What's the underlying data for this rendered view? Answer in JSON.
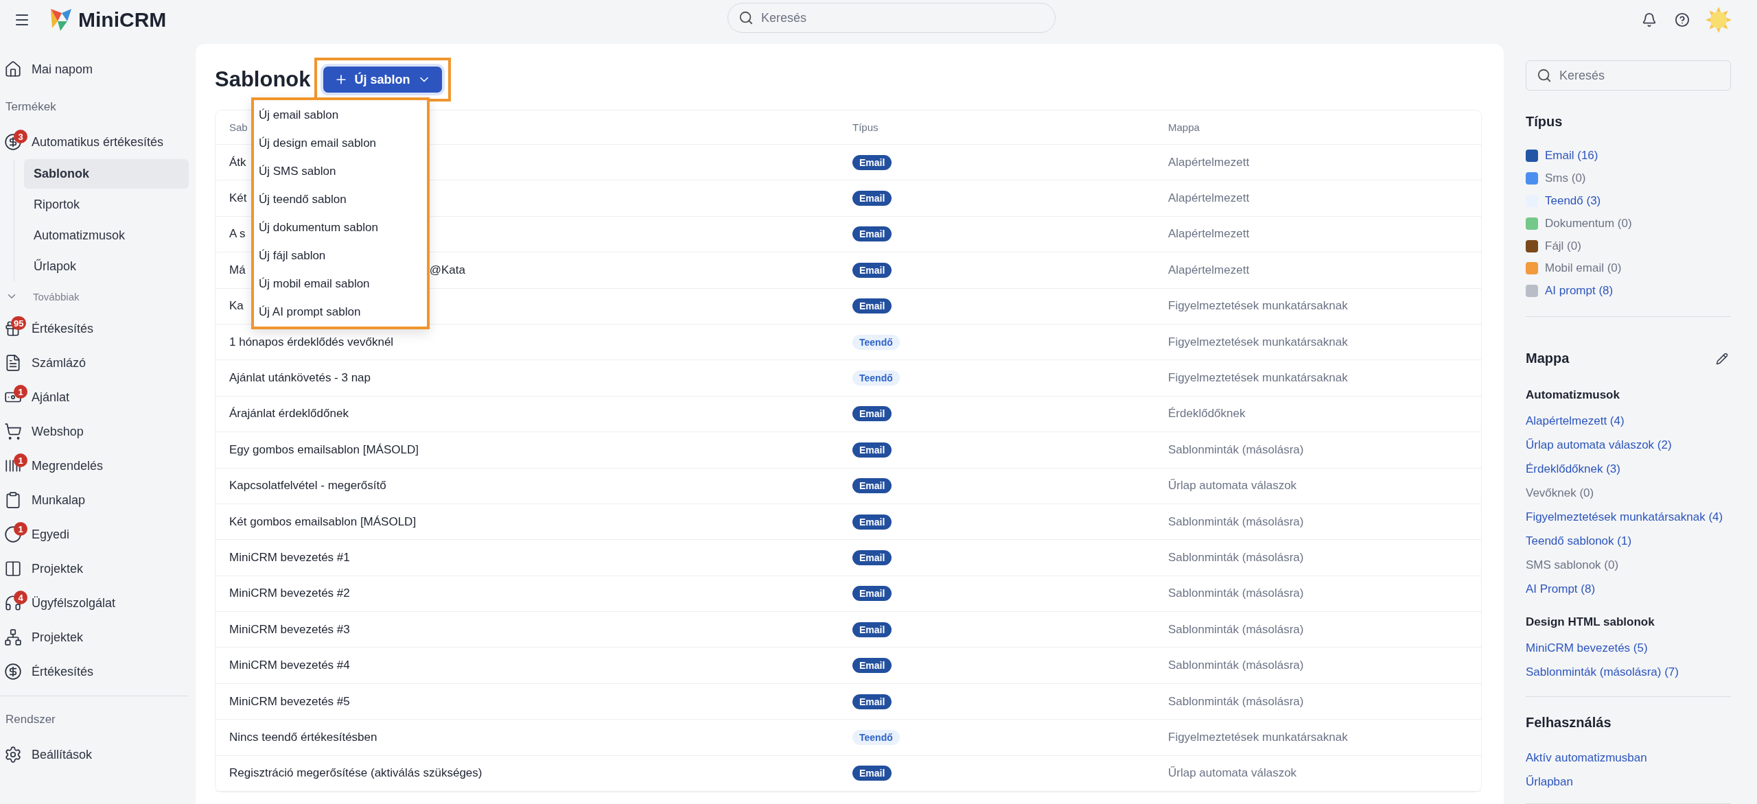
{
  "topbar": {
    "logo": "MiniCRM",
    "search": {
      "placeholder": "Keresés"
    }
  },
  "sidebar": {
    "items": [
      {
        "kind": "item",
        "label": "Mai napom",
        "selected": false
      },
      {
        "kind": "section",
        "label": "Termékek"
      },
      {
        "kind": "item",
        "label": "Automatikus értékesítés",
        "badge": "3",
        "selected": false,
        "children": [
          {
            "label": "Sablonok",
            "selected": true
          },
          {
            "label": "Riportok",
            "selected": false
          },
          {
            "label": "Automatizmusok",
            "selected": false
          },
          {
            "label": "Űrlapok",
            "selected": false
          }
        ]
      },
      {
        "kind": "toggle",
        "label": "Továbbiak",
        "expanded": true
      },
      {
        "kind": "item",
        "label": "Értékesítés",
        "badge": "95",
        "selected": false
      },
      {
        "kind": "item",
        "label": "Számlázó",
        "selected": false
      },
      {
        "kind": "item",
        "label": "Ajánlat",
        "badge": "1",
        "selected": false
      },
      {
        "kind": "item",
        "label": "Webshop",
        "selected": false
      },
      {
        "kind": "item",
        "label": "Megrendelés",
        "badge": "1",
        "selected": false
      },
      {
        "kind": "item",
        "label": "Munkalap",
        "selected": false
      },
      {
        "kind": "item",
        "label": "Egyedi",
        "badge": "1",
        "selected": false
      },
      {
        "kind": "item",
        "label": "Projektek",
        "selected": false
      },
      {
        "kind": "item",
        "label": "Ügyfélszolgálat",
        "badge": "4",
        "selected": false
      },
      {
        "kind": "item",
        "label": "Projektek",
        "selected": false
      },
      {
        "kind": "item",
        "label": "Értékesítés",
        "selected": false
      },
      {
        "kind": "divider"
      },
      {
        "kind": "section",
        "label": "Rendszer"
      },
      {
        "kind": "item",
        "label": "Beállítások",
        "selected": false
      }
    ]
  },
  "page": {
    "title": "Sablonok",
    "new_button": {
      "label": "Új sablon",
      "expanded": true,
      "highlighted": true
    },
    "menu": {
      "highlighted": true,
      "items": [
        "Új email sablon",
        "Új design email sablon",
        "Új SMS sablon",
        "Új teendő sablon",
        "Új dokumentum sablon",
        "Új fájl sablon",
        "Új mobil email sablon",
        "Új AI prompt sablon"
      ]
    }
  },
  "table": {
    "columns": [
      "Sab",
      "Típus",
      "Mappa"
    ],
    "rows": [
      {
        "name": "Átk",
        "type": "Email",
        "kind": "email",
        "folder": "Alapértelmezett"
      },
      {
        "name": "Két",
        "type": "Email",
        "kind": "email",
        "folder": "Alapértelmezett"
      },
      {
        "name": "A s",
        "type": "Email",
        "kind": "email",
        "folder": "Alapértelmezett"
      },
      {
        "name": "Má",
        "name_tail": "@Kata",
        "type": "Email",
        "kind": "email",
        "folder": "Alapértelmezett"
      },
      {
        "name": "Ka",
        "type": "Email",
        "kind": "email",
        "folder": "Figyelmeztetések munkatársaknak"
      },
      {
        "name": "1 hónapos érdeklődés vevőknél",
        "type": "Teendő",
        "kind": "task",
        "folder": "Figyelmeztetések munkatársaknak"
      },
      {
        "name": "Ajánlat utánkövetés - 3 nap",
        "type": "Teendő",
        "kind": "task",
        "folder": "Figyelmeztetések munkatársaknak"
      },
      {
        "name": "Árajánlat érdeklődőnek",
        "type": "Email",
        "kind": "email",
        "folder": "Érdeklődőknek"
      },
      {
        "name": "Egy gombos emailsablon [MÁSOLD]",
        "type": "Email",
        "kind": "email",
        "folder": "Sablonminták (másolásra)"
      },
      {
        "name": "Kapcsolatfelvétel - megerősítő",
        "type": "Email",
        "kind": "email",
        "folder": "Űrlap automata válaszok"
      },
      {
        "name": "Két gombos emailsablon [MÁSOLD]",
        "type": "Email",
        "kind": "email",
        "folder": "Sablonminták (másolásra)"
      },
      {
        "name": "MiniCRM bevezetés #1",
        "type": "Email",
        "kind": "email",
        "folder": "Sablonminták (másolásra)"
      },
      {
        "name": "MiniCRM bevezetés #2",
        "type": "Email",
        "kind": "email",
        "folder": "Sablonminták (másolásra)"
      },
      {
        "name": "MiniCRM bevezetés #3",
        "type": "Email",
        "kind": "email",
        "folder": "Sablonminták (másolásra)"
      },
      {
        "name": "MiniCRM bevezetés #4",
        "type": "Email",
        "kind": "email",
        "folder": "Sablonminták (másolásra)"
      },
      {
        "name": "MiniCRM bevezetés #5",
        "type": "Email",
        "kind": "email",
        "folder": "Sablonminták (másolásra)"
      },
      {
        "name": "Nincs teendő értékesítésben",
        "type": "Teendő",
        "kind": "task",
        "folder": "Figyelmeztetések munkatársaknak"
      },
      {
        "name": "Regisztráció megerősítése (aktiválás szükséges)",
        "type": "Email",
        "kind": "email",
        "folder": "Űrlap automata válaszok"
      }
    ]
  },
  "filters": {
    "search": {
      "placeholder": "Keresés"
    },
    "type": {
      "title": "Típus",
      "items": [
        {
          "label": "Email (16)",
          "color": "#2355a6",
          "disabled": false
        },
        {
          "label": "Sms (0)",
          "color": "#4a8ef0",
          "disabled": true
        },
        {
          "label": "Teendő (3)",
          "color": "#eaf2fd",
          "disabled": false
        },
        {
          "label": "Dokumentum (0)",
          "color": "#74c98a",
          "disabled": true
        },
        {
          "label": "Fájl (0)",
          "color": "#7a4a1a",
          "disabled": true
        },
        {
          "label": "Mobil email (0)",
          "color": "#f29a3c",
          "disabled": true
        },
        {
          "label": "AI prompt (8)",
          "color": "#b9bec6",
          "disabled": false
        }
      ]
    },
    "folder": {
      "title": "Mappa",
      "groups": [
        {
          "title": "Automatizmusok",
          "links": [
            {
              "label": "Alapértelmezett (4)",
              "disabled": false
            },
            {
              "label": "Űrlap automata válaszok (2)",
              "disabled": false
            },
            {
              "label": "Érdeklődőknek (3)",
              "disabled": false
            },
            {
              "label": "Vevőknek (0)",
              "disabled": true
            },
            {
              "label": "Figyelmeztetések munkatársaknak (4)",
              "disabled": false
            },
            {
              "label": "Teendő sablonok (1)",
              "disabled": false
            },
            {
              "label": "SMS sablonok (0)",
              "disabled": true
            },
            {
              "label": "AI Prompt (8)",
              "disabled": false
            }
          ]
        },
        {
          "title": "Design HTML sablonok",
          "links": [
            {
              "label": "MiniCRM bevezetés (5)",
              "disabled": false
            },
            {
              "label": "Sablonminták (másolásra) (7)",
              "disabled": false
            }
          ]
        }
      ]
    },
    "usage": {
      "title": "Felhasználás",
      "links": [
        {
          "label": "Aktív automatizmusban",
          "disabled": false
        },
        {
          "label": "Űrlapban",
          "disabled": false
        }
      ]
    }
  }
}
